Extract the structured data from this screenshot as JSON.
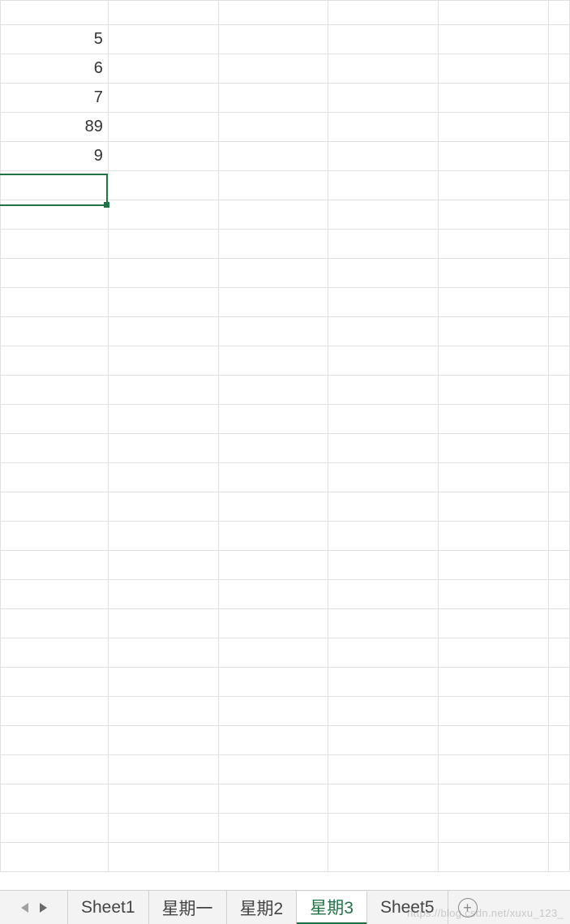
{
  "cells": {
    "col_a": [
      "",
      "5",
      "6",
      "7",
      "89",
      "9"
    ]
  },
  "sheet_tabs": {
    "items": [
      {
        "label": "Sheet1",
        "active": false
      },
      {
        "label": "星期一",
        "active": false
      },
      {
        "label": "星期2",
        "active": false
      },
      {
        "label": "星期3",
        "active": true
      },
      {
        "label": "Sheet5",
        "active": false
      }
    ]
  },
  "add_sheet_glyph": "+",
  "watermark": "https://blog.csdn.net/xuxu_123_"
}
